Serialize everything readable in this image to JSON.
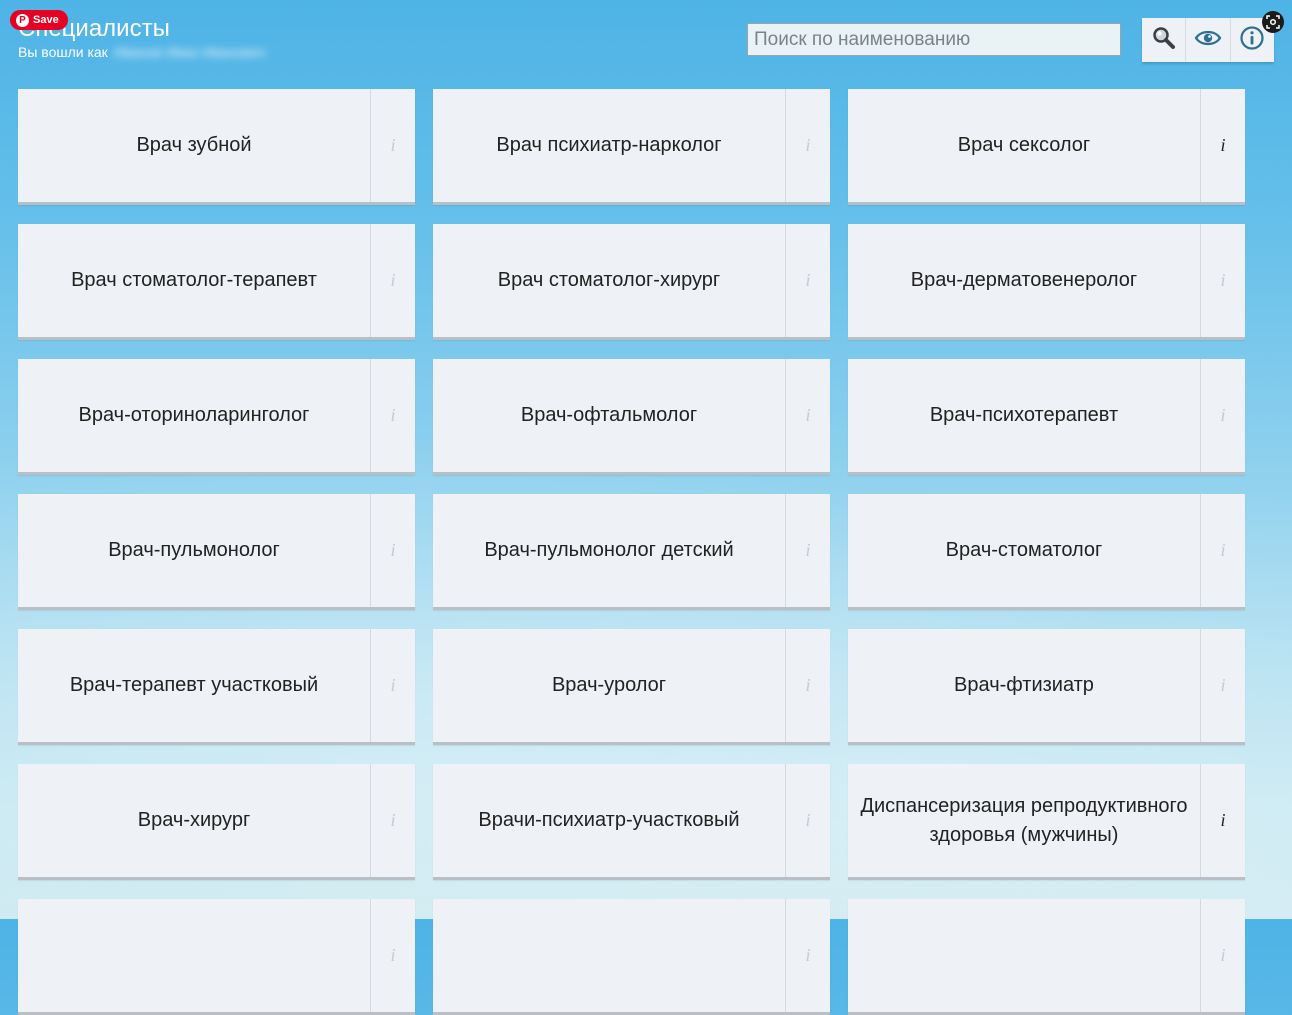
{
  "header": {
    "title": "Специалисты",
    "subtitle": "Вы вошли как",
    "user_name": "Иванов Иван Иванович"
  },
  "overlay": {
    "save_label": "Save",
    "pin_glyph": "P"
  },
  "search": {
    "placeholder": "Поиск по наименованию"
  },
  "toolbar": {
    "buttons": [
      "search-icon",
      "eye-icon",
      "info-icon"
    ]
  },
  "info_glyph": "i",
  "colors": {
    "accent_red": "#e60023",
    "card_bg": "#eef1f6",
    "info_inactive": "#c4cbd1",
    "info_active": "#222222"
  },
  "specialists": [
    {
      "label": "Врач зубной",
      "info_active": false
    },
    {
      "label": "Врач психиатр-нарколог",
      "info_active": false
    },
    {
      "label": "Врач сексолог",
      "info_active": true
    },
    {
      "label": "Врач стоматолог-терапевт",
      "info_active": false
    },
    {
      "label": "Врач стоматолог-хирург",
      "info_active": false
    },
    {
      "label": "Врач-дерматовенеролог",
      "info_active": false
    },
    {
      "label": "Врач-оториноларинголог",
      "info_active": false
    },
    {
      "label": "Врач-офтальмолог",
      "info_active": false
    },
    {
      "label": "Врач-психотерапевт",
      "info_active": false
    },
    {
      "label": "Врач-пульмонолог",
      "info_active": false
    },
    {
      "label": "Врач-пульмонолог детский",
      "info_active": false
    },
    {
      "label": "Врач-стоматолог",
      "info_active": false
    },
    {
      "label": "Врач-терапевт участковый",
      "info_active": false
    },
    {
      "label": "Врач-уролог",
      "info_active": false
    },
    {
      "label": "Врач-фтизиатр",
      "info_active": false
    },
    {
      "label": "Врач-хирург",
      "info_active": false
    },
    {
      "label": "Врачи-психиатр-участковый",
      "info_active": false
    },
    {
      "label": "Диспансеризация репродуктивного здоровья (мужчины)",
      "info_active": true
    },
    {
      "label": "",
      "info_active": false
    },
    {
      "label": "",
      "info_active": false
    },
    {
      "label": "",
      "info_active": false
    }
  ]
}
